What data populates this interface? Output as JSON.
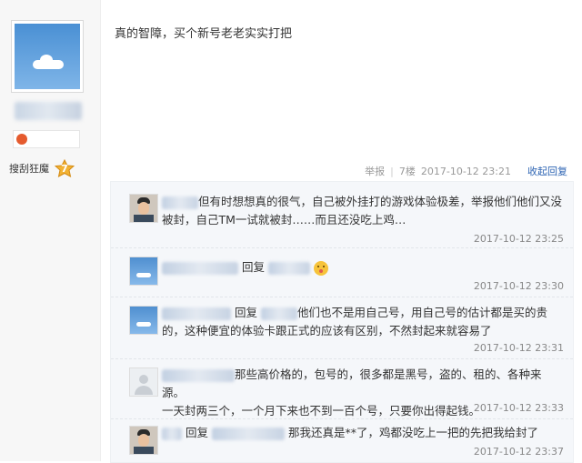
{
  "post": {
    "text": "真的智障，买个新号老老实实打把",
    "report": "举报",
    "floor": "7楼",
    "time": "2017-10-12 23:21",
    "collapse": "收起回复"
  },
  "author": {
    "grade_name": "搜刮狂魔",
    "grade_level": "7"
  },
  "replies": [
    {
      "avatar": "person-avatar",
      "text_line1": "但有时想想真的很气，自己被外挂打的游戏体验极差，举报他们他们又没",
      "text_line2": "被封，自己TM一试就被封……而且还没吃上鸡…",
      "time": "2017-10-12 23:25"
    },
    {
      "avatar": "sky-avatar",
      "reply_word": "回复",
      "emoji": "surprised-emoji",
      "time": "2017-10-12 23:30"
    },
    {
      "avatar": "sky-avatar",
      "reply_word": "回复",
      "text_line1": "他们也不是用自己号，用自己号的估计都是买的贵",
      "text_line2": "的，这种便宜的体验卡跟正式的应该有区别，不然封起来就容易了",
      "time": "2017-10-12 23:31"
    },
    {
      "avatar": "default-gray-avatar",
      "text_line1": "那些高价格的，包号的，很多都是黑号，盗的、租的、各种来源。",
      "text_line2": "一天封两三个，一个月下来也不到一百个号，只要你出得起钱。",
      "time": "2017-10-12 23:33"
    },
    {
      "avatar": "person-avatar",
      "reply_word": "回复",
      "text_line1": "那我还真是**了，鸡都没吃上一把的先把我给封了",
      "time": "2017-10-12 23:37"
    }
  ],
  "colors": {
    "link": "#2d64b3",
    "reply_bg": "#f5f7fa",
    "meta_gray": "#888888"
  }
}
